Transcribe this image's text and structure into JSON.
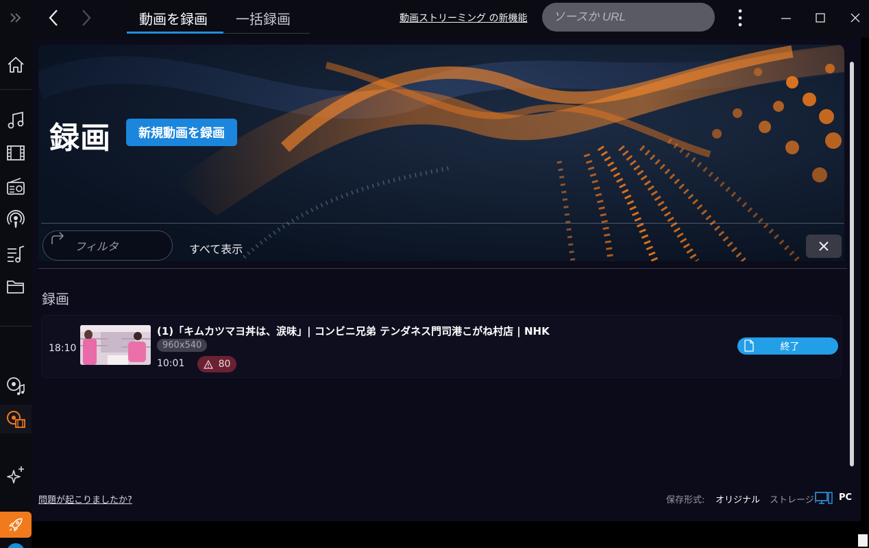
{
  "topbar": {
    "tabs": [
      {
        "label": "動画を録画",
        "active": true
      },
      {
        "label": "一括録画",
        "active": false
      }
    ],
    "news_link": "動画ストリーミング の新機能",
    "search_placeholder": "ソースか URL"
  },
  "hero": {
    "title": "録画",
    "new_record_button": "新規動画を録画"
  },
  "filter": {
    "placeholder": "フィルタ",
    "show_all": "すべて表示"
  },
  "section": {
    "title": "録画"
  },
  "recordings": [
    {
      "time": "18:10",
      "title": "(1)「キムカツマヨ丼は、涙味」| コンビニ兄弟 テンダネス門司港こがね村店 | NHK",
      "resolution": "960x540",
      "duration": "10:01",
      "warnings": "80",
      "status_button": "終了"
    }
  ],
  "footer": {
    "help_link": "問題が起こりましたか?",
    "format_label": "保存形式:",
    "format_value": "オリジナル",
    "storage_label": "ストレージ:",
    "storage_value": "PC"
  },
  "colors": {
    "accent": "#1b86db",
    "done": "#239fe8",
    "warning": "#6a2131",
    "brand_orange": "#f07a1c"
  },
  "icons": {
    "sidebar": [
      "expand-icon",
      "home-icon",
      "music-icon",
      "film-icon",
      "radio-icon",
      "podcast-icon",
      "playlist-icon",
      "folder-icon",
      "music-recorder-icon",
      "video-recorder-icon",
      "sparkle-icon",
      "rocket-icon"
    ]
  }
}
